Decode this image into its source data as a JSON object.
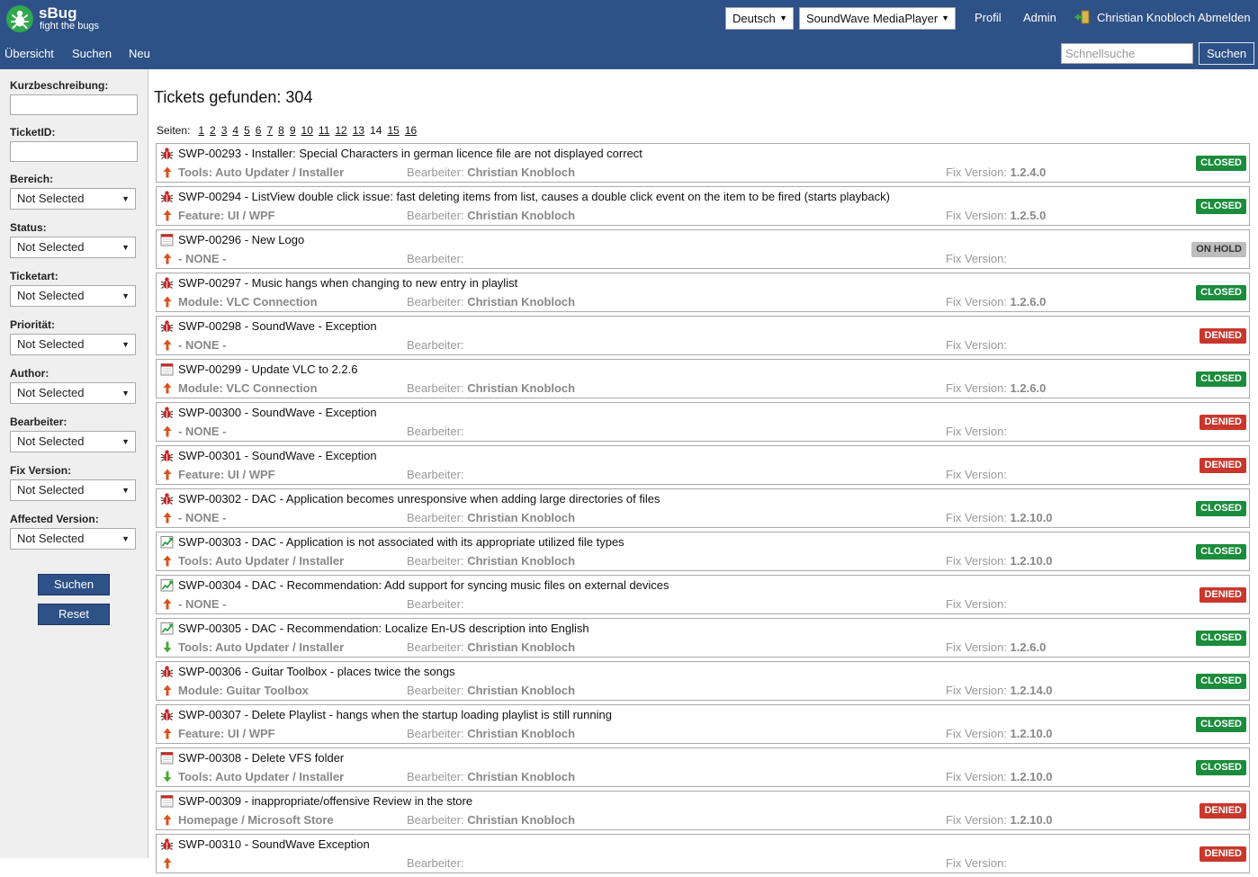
{
  "app": {
    "name": "sBug",
    "tagline": "fight the bugs"
  },
  "header": {
    "language": "Deutsch",
    "project": "SoundWave MediaPlayer",
    "profile_label": "Profil",
    "admin_label": "Admin",
    "user_label": "Christian Knobloch Abmelden"
  },
  "nav": {
    "overview": "Übersicht",
    "search": "Suchen",
    "new": "Neu"
  },
  "quicksearch": {
    "placeholder": "Schnellsuche",
    "button": "Suchen"
  },
  "sidebar": {
    "short_desc_label": "Kurzbeschreibung:",
    "ticketid_label": "TicketID:",
    "filters": [
      {
        "label": "Bereich:",
        "value": "Not Selected"
      },
      {
        "label": "Status:",
        "value": "Not Selected"
      },
      {
        "label": "Ticketart:",
        "value": "Not Selected"
      },
      {
        "label": "Priorität:",
        "value": "Not Selected"
      },
      {
        "label": "Author:",
        "value": "Not Selected"
      },
      {
        "label": "Bearbeiter:",
        "value": "Not Selected"
      },
      {
        "label": "Fix Version:",
        "value": "Not Selected"
      },
      {
        "label": "Affected Version:",
        "value": "Not Selected"
      }
    ],
    "search_button": "Suchen",
    "reset_button": "Reset"
  },
  "results": {
    "title": "Tickets gefunden: 304",
    "pages_label": "Seiten:",
    "pages": [
      "1",
      "2",
      "3",
      "4",
      "5",
      "6",
      "7",
      "8",
      "9",
      "10",
      "11",
      "12",
      "13",
      "14",
      "15",
      "16"
    ],
    "current_page": "14",
    "assignee_label": "Bearbeiter:",
    "fix_label": "Fix Version:"
  },
  "tickets": [
    {
      "title": "SWP-00293 - Installer: Special Characters in german licence file are not displayed correct",
      "type": "bug",
      "priority": "up",
      "area": "Tools: Auto Updater / Installer",
      "assignee": "Christian Knobloch",
      "fix_version": "1.2.4.0",
      "status": "CLOSED"
    },
    {
      "title": "SWP-00294 - ListView double click issue: fast deleting items from list, causes a double click event on the item to be fired (starts playback)",
      "type": "bug",
      "priority": "up",
      "area": "Feature: UI / WPF",
      "assignee": "Christian Knobloch",
      "fix_version": "1.2.5.0",
      "status": "CLOSED"
    },
    {
      "title": "SWP-00296 - New Logo",
      "type": "task",
      "priority": "up",
      "area": "- NONE -",
      "assignee": "",
      "fix_version": "",
      "status": "ON HOLD"
    },
    {
      "title": "SWP-00297 - Music hangs when changing to new entry in playlist",
      "type": "bug",
      "priority": "up",
      "area": "Module: VLC Connection",
      "assignee": "Christian Knobloch",
      "fix_version": "1.2.6.0",
      "status": "CLOSED"
    },
    {
      "title": "SWP-00298 - SoundWave - Exception",
      "type": "bug",
      "priority": "up",
      "area": "- NONE -",
      "assignee": "",
      "fix_version": "",
      "status": "DENIED"
    },
    {
      "title": "SWP-00299 - Update VLC to 2.2.6",
      "type": "task",
      "priority": "up",
      "area": "Module: VLC Connection",
      "assignee": "Christian Knobloch",
      "fix_version": "1.2.6.0",
      "status": "CLOSED"
    },
    {
      "title": "SWP-00300 - SoundWave - Exception",
      "type": "bug",
      "priority": "up",
      "area": "- NONE -",
      "assignee": "",
      "fix_version": "",
      "status": "DENIED"
    },
    {
      "title": "SWP-00301 - SoundWave - Exception",
      "type": "bug",
      "priority": "up",
      "area": "Feature: UI / WPF",
      "assignee": "",
      "fix_version": "",
      "status": "DENIED"
    },
    {
      "title": "SWP-00302 - DAC - Application becomes unresponsive when adding large directories of files",
      "type": "bug",
      "priority": "up",
      "area": "- NONE -",
      "assignee": "Christian Knobloch",
      "fix_version": "1.2.10.0",
      "status": "CLOSED"
    },
    {
      "title": "SWP-00303 - DAC - Application is not associated with its appropriate utilized file types",
      "type": "improvement",
      "priority": "up",
      "area": "Tools: Auto Updater / Installer",
      "assignee": "Christian Knobloch",
      "fix_version": "1.2.10.0",
      "status": "CLOSED"
    },
    {
      "title": "SWP-00304 - DAC - Recommendation: Add support for syncing music files on external devices",
      "type": "improvement",
      "priority": "up",
      "area": "- NONE -",
      "assignee": "",
      "fix_version": "",
      "status": "DENIED"
    },
    {
      "title": "SWP-00305 - DAC - Recommendation: Localize En-US description into English",
      "type": "improvement",
      "priority": "down",
      "area": "Tools: Auto Updater / Installer",
      "assignee": "Christian Knobloch",
      "fix_version": "1.2.6.0",
      "status": "CLOSED"
    },
    {
      "title": "SWP-00306 - Guitar Toolbox - places twice the songs",
      "type": "bug",
      "priority": "up",
      "area": "Module: Guitar Toolbox",
      "assignee": "Christian Knobloch",
      "fix_version": "1.2.14.0",
      "status": "CLOSED"
    },
    {
      "title": "SWP-00307 - Delete Playlist - hangs when the startup loading playlist is still running",
      "type": "bug",
      "priority": "up",
      "area": "Feature: UI / WPF",
      "assignee": "Christian Knobloch",
      "fix_version": "1.2.10.0",
      "status": "CLOSED"
    },
    {
      "title": "SWP-00308 - Delete VFS folder",
      "type": "task",
      "priority": "down",
      "area": "Tools: Auto Updater / Installer",
      "assignee": "Christian Knobloch",
      "fix_version": "1.2.10.0",
      "status": "CLOSED"
    },
    {
      "title": "SWP-00309 - inappropriate/offensive Review in the store",
      "type": "task",
      "priority": "up",
      "area": "Homepage / Microsoft Store",
      "assignee": "Christian Knobloch",
      "fix_version": "1.2.10.0",
      "status": "DENIED"
    },
    {
      "title": "SWP-00310 - SoundWave Exception",
      "type": "bug",
      "priority": "up",
      "area": "",
      "assignee": "",
      "fix_version": "",
      "status": "DENIED"
    }
  ],
  "colors": {
    "header_bg": "#2e5187",
    "closed": "#1a8c3b",
    "denied": "#c9372c",
    "on_hold": "#bdbdbd"
  }
}
